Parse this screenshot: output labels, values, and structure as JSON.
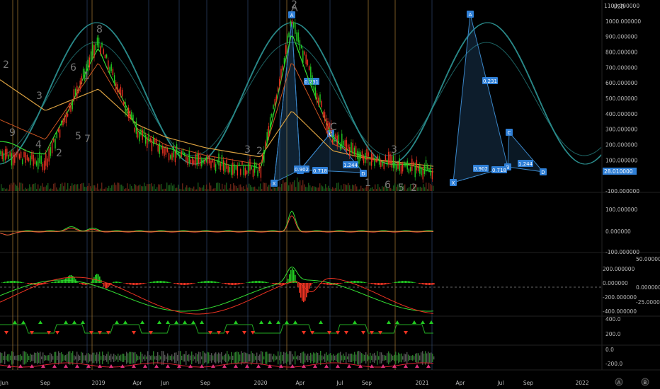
{
  "colors": {
    "background": "#000000",
    "bull": "#22cc22",
    "bear": "#ee3322",
    "pattern": "#3a86c8",
    "pattern_label": "#2f7fd6",
    "cycle": "#2a8c8c",
    "ma": "#d9a040",
    "divider": "#222222"
  },
  "icons": {
    "log_toggle": "letter-a-icon",
    "settings": "letter-b-icon"
  },
  "price_axis": {
    "currency": "USD",
    "last_price": "28.010000",
    "ticks": [
      "1100.000000",
      "1000.000000",
      "900.000000",
      "800.000000",
      "700.000000",
      "600.000000",
      "500.000000",
      "400.000000",
      "300.000000",
      "200.000000",
      "100.000000",
      "-100.000000"
    ]
  },
  "osc1_axis": {
    "ticks": [
      "100.000000",
      "0.000000",
      "-100.000000"
    ]
  },
  "osc2_axis": {
    "left_ticks": [
      "200.000000",
      "0.000000",
      "-200.000000",
      "-400.000000"
    ],
    "right_ticks": [
      "50.000000",
      "0.000000",
      "-25.000000"
    ]
  },
  "osc3_axis": {
    "ticks": [
      "400.0",
      "200.0",
      "0.0",
      "-200.0"
    ]
  },
  "time_axis": {
    "labels": [
      "Jun",
      "Sep",
      "2019",
      "Apr",
      "Jun",
      "Sep",
      "2020",
      "Apr",
      "Jul",
      "Sep",
      "2021",
      "Apr",
      "Jul",
      "Sep",
      "2022"
    ]
  },
  "harmonic_historic": {
    "points": [
      "X",
      "A",
      "B",
      "C",
      "D"
    ],
    "ratios": [
      "0.231",
      "0.902",
      "0.718",
      "1.244"
    ]
  },
  "harmonic_projected": {
    "points": [
      "X",
      "A",
      "B",
      "C",
      "D"
    ],
    "ratios": [
      "0.231",
      "0.902",
      "0.718",
      "1.244"
    ]
  },
  "wave_counts": [
    "2",
    "8",
    "6",
    "1",
    "3",
    "4",
    "5",
    "7",
    "9",
    "2",
    "3",
    "2",
    "A",
    "2",
    "C",
    "1",
    "6",
    "5",
    "2",
    "3"
  ],
  "chart_data": {
    "type": "line",
    "title": "",
    "xlabel": "",
    "ylabel": "USD",
    "ylim": [
      -100,
      1100
    ],
    "grid": false,
    "x": [
      "Jun",
      "Sep",
      "2019",
      "Apr",
      "Jun",
      "Sep",
      "2020",
      "Apr",
      "Jul",
      "Sep",
      "2021"
    ],
    "series": [
      {
        "values": [
          150,
          80,
          870,
          280,
          160,
          90,
          30,
          1000,
          240,
          110,
          28
        ]
      },
      {
        "values": [
          620,
          420,
          560,
          330,
          250,
          180,
          120,
          420,
          160,
          110,
          60
        ]
      }
    ]
  }
}
